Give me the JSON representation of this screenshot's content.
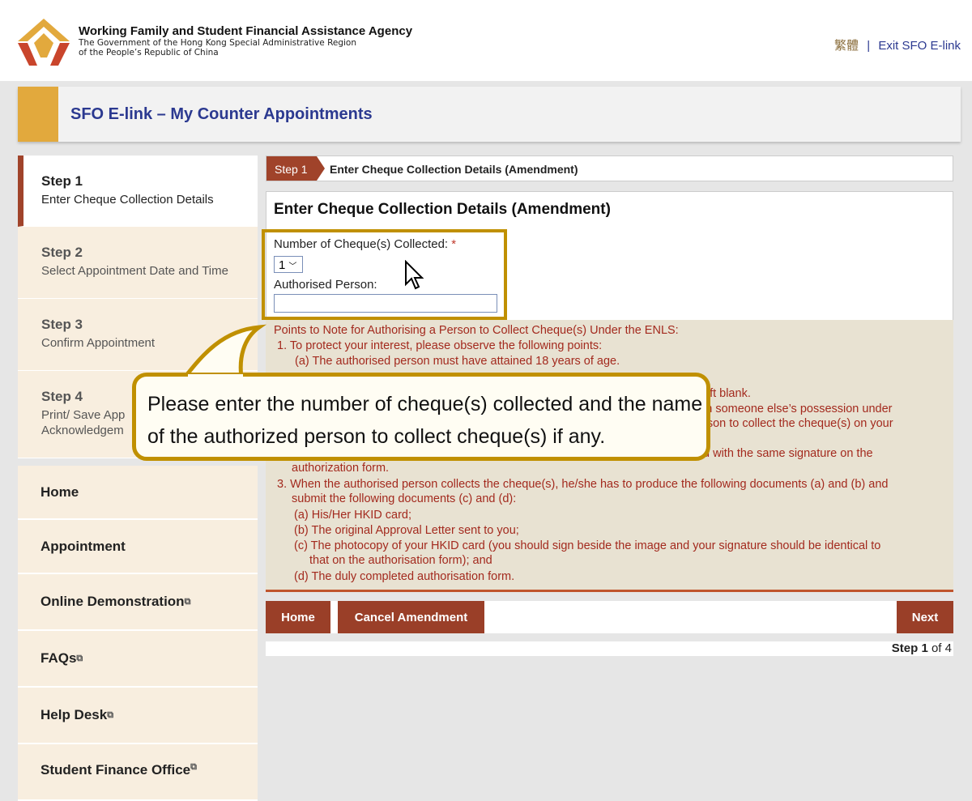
{
  "header": {
    "agency": "Working Family and Student Financial Assistance Agency",
    "gov_line1": "The Government of the Hong Kong Special Administrative Region",
    "gov_line2": "of the People’s Republic of China",
    "lang_link": "繁體",
    "separator": "|",
    "exit_link": "Exit SFO E-link"
  },
  "title": "SFO E-link – My Counter Appointments",
  "steps": [
    {
      "num": "Step 1",
      "label": "Enter Cheque Collection Details"
    },
    {
      "num": "Step 2",
      "label": "Select Appointment Date and Time"
    },
    {
      "num": "Step 3",
      "label": "Confirm Appointment"
    },
    {
      "num": "Step 4",
      "label": "Print/ Save App",
      "label2": "Acknowledgem"
    }
  ],
  "nav": [
    {
      "label": "Home"
    },
    {
      "label": "Appointment"
    },
    {
      "label": "Online Demonstration"
    },
    {
      "label": "FAQs"
    },
    {
      "label": "Help Desk"
    },
    {
      "label": "Student Finance Office"
    }
  ],
  "breadcrumb": {
    "step": "Step 1",
    "label": "Enter Cheque Collection Details (Amendment)"
  },
  "form": {
    "heading": "Enter Cheque Collection Details (Amendment)",
    "cheques_label": "Number of Cheque(s) Collected:",
    "required": "*",
    "cheques_value": "1",
    "person_label": "Authorised Person:",
    "person_value": ""
  },
  "notes": {
    "title": "Points to Note for Authorising a Person to Collect Cheque(s) Under the ENLS:",
    "l1": "1. To protect your interest, please observe the following points:",
    "l1a": "(a) The authorised person must have attained 18 years of age.",
    "f1": "eft blank.",
    "f2": "in someone else’s possession under",
    "f3": "rson to collect the cheque(s) on your",
    "f4": "u with the same signature on the",
    "f5": "authorization form.",
    "l3": "3. When the authorised person collects the cheque(s), he/she has to produce the following documents (a) and (b) and",
    "l3b": "submit the following documents (c) and (d):",
    "a": "(a) His/Her HKID card;",
    "b": "(b) The original Approval Letter sent to you;",
    "c": "(c) The photocopy of your HKID card (you should sign beside the image and your signature should be identical to",
    "c2": "that on the authorisation form); and",
    "d": "(d) The duly completed authorisation form."
  },
  "buttons": {
    "home": "Home",
    "cancel": "Cancel Amendment",
    "next": "Next"
  },
  "step_counter": {
    "current": "Step 1",
    "of": "of 4"
  },
  "callout": "Please enter the number of cheque(s) collected and the name of the authorized person to collect cheque(s) if any.",
  "colors": {
    "accent": "#a0432a",
    "brand": "#2b3990",
    "highlight": "#c09000",
    "gold": "#e2a93d"
  }
}
